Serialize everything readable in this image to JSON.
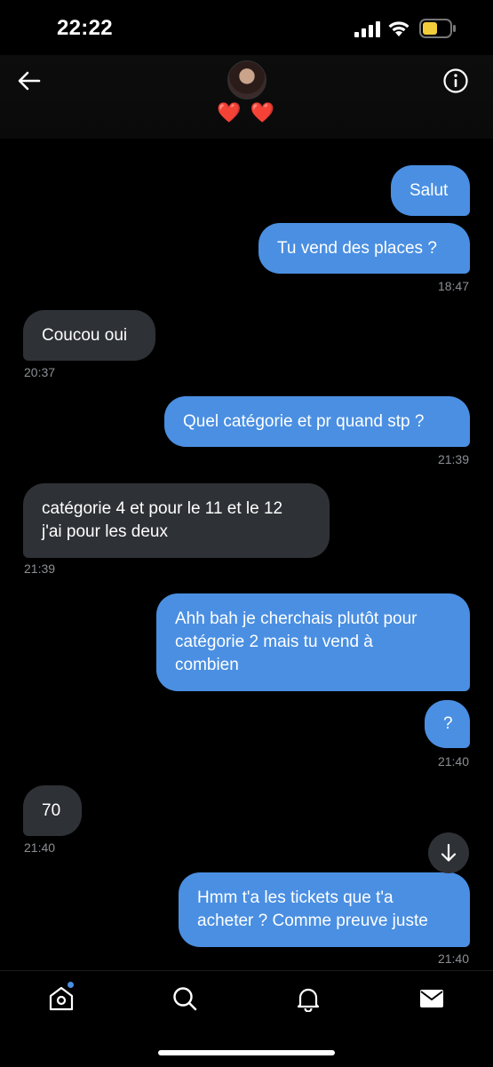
{
  "status_bar": {
    "time": "22:22"
  },
  "header": {
    "status_emoji": "❤️ ❤️"
  },
  "messages": [
    {
      "text": "Salut"
    },
    {
      "text": "Tu vend des places ?",
      "time": "18:47"
    },
    {
      "text": "Coucou oui",
      "time": "20:37"
    },
    {
      "text": "Quel catégorie et pr quand stp ?",
      "time": "21:39"
    },
    {
      "text": "catégorie 4 et pour le 11 et le 12\nj'ai pour les deux",
      "time": "21:39"
    },
    {
      "text": "Ahh bah je cherchais plutôt pour\ncatégorie 2 mais tu vend à\ncombien"
    },
    {
      "text": "?",
      "time": "21:40"
    },
    {
      "text": "70",
      "time": "21:40"
    },
    {
      "text": "Hmm t'a les tickets que t'a\nacheter ? Comme preuve juste",
      "time": "21:40"
    }
  ],
  "nav": {
    "items": [
      "home-icon",
      "search-icon",
      "bell-icon",
      "mail-icon"
    ],
    "notification_color": "#4a8fe2"
  },
  "colors": {
    "sent_bubble": "#4a8fe2",
    "received_bubble": "#2e3135",
    "background": "#000000"
  }
}
